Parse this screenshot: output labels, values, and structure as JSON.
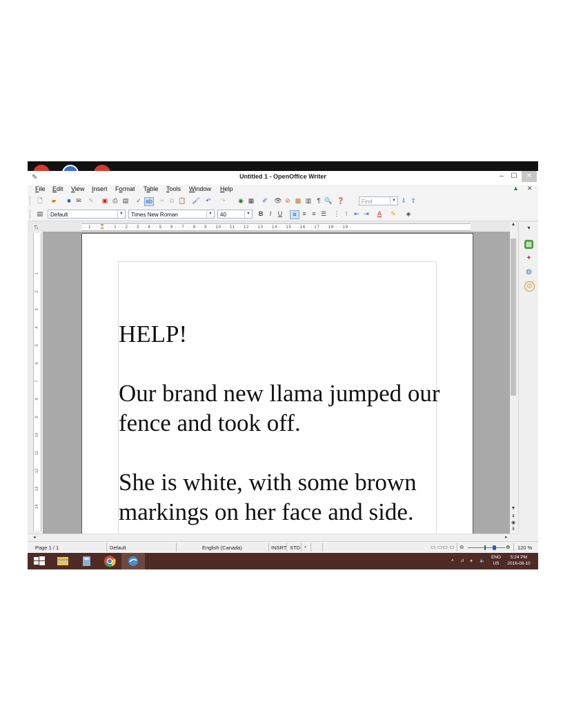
{
  "window": {
    "title": "Untitled 1 - OpenOffice Writer",
    "minimize": "–",
    "maximize": "☐",
    "close": "✕"
  },
  "menu": {
    "items": [
      {
        "label": "File",
        "key": "F",
        "rest": "ile"
      },
      {
        "label": "Edit",
        "key": "E",
        "rest": "dit"
      },
      {
        "label": "View",
        "key": "V",
        "rest": "iew"
      },
      {
        "label": "Insert",
        "key": "I",
        "rest": "nsert"
      },
      {
        "label": "Format",
        "key": "o",
        "pre": "F",
        "rest": "rmat"
      },
      {
        "label": "Table",
        "key": "a",
        "pre": "T",
        "rest": "ble"
      },
      {
        "label": "Tools",
        "key": "T",
        "rest": "ools"
      },
      {
        "label": "Window",
        "key": "W",
        "rest": "indow"
      },
      {
        "label": "Help",
        "key": "H",
        "rest": "elp"
      }
    ],
    "close_doc": "✕"
  },
  "toolbar": {
    "find_placeholder": "Find"
  },
  "formatting": {
    "paragraph_style": "Default",
    "font_name": "Times New Roman",
    "font_size": "40",
    "bold": "B",
    "italic": "I",
    "underline": "U"
  },
  "ruler": {
    "horizontal_ticks": "· · 1 · · ⌛ · · 1 · · 2 · · 3 · · 4 · · 5 · · 6 · · 7 · · 8 · · 9 · · 10 · · 11 · · 12 · · 13 · · 14 · · 15 · · 16 · · 17 · · 18 · · 19 ·",
    "vertical_ticks": [
      "1",
      "1",
      "2",
      "3",
      "4",
      "5",
      "6",
      "7",
      "8",
      "9",
      "10",
      "11",
      "12",
      "13",
      "14"
    ]
  },
  "document": {
    "paragraphs": [
      "HELP!",
      "Our brand new llama jumped our fence and took off.",
      "She is white, with some brown markings on her face and side."
    ]
  },
  "statusbar": {
    "page": "Page 1 / 1",
    "page_style": "Default",
    "language": "English (Canada)",
    "insert_mode": "INSRT",
    "selection_mode": "STD",
    "modified": "*",
    "zoom": "120 %"
  },
  "taskbar": {
    "lang_top": "ENG",
    "lang_bottom": "US",
    "time": "5:24 PM",
    "date": "2016-08-10"
  },
  "colors": {
    "taskbar": "#4f2b25",
    "workspace_gray": "#a9a9a9",
    "chrome": "#f0f0f0"
  }
}
